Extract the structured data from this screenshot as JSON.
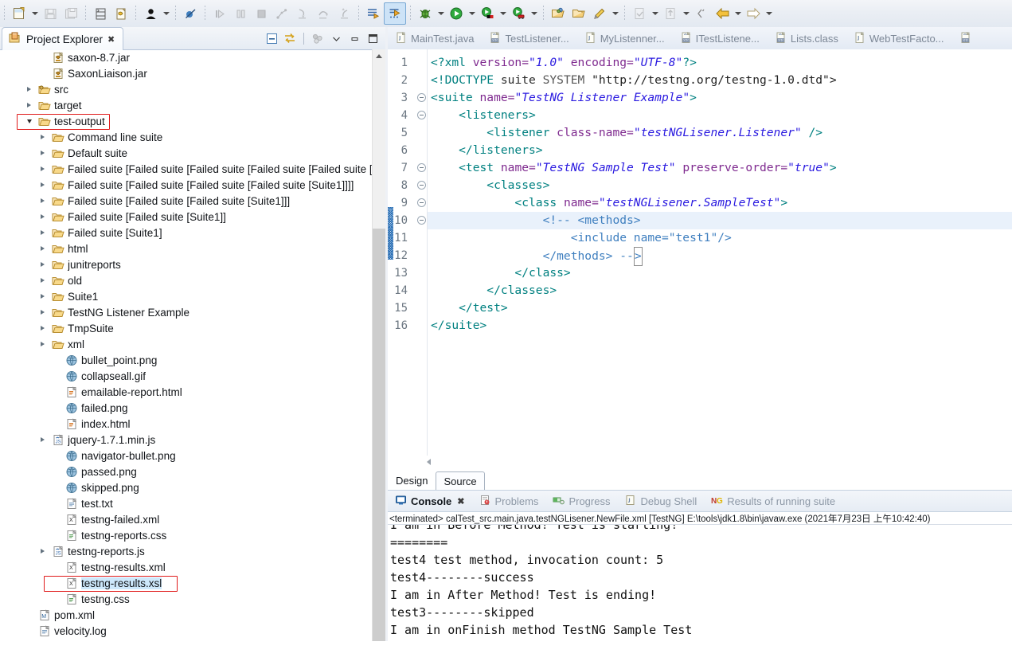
{
  "toolbar": {
    "groups": [
      {
        "items": [
          {
            "icon": "new-wizard-icon",
            "name": "new-button",
            "dropdown": true,
            "enabled": true
          },
          {
            "icon": "save-icon",
            "name": "save-button",
            "dropdown": false,
            "enabled": false
          },
          {
            "icon": "save-all-icon",
            "name": "save-all-button",
            "dropdown": false,
            "enabled": false
          }
        ]
      },
      {
        "items": [
          {
            "icon": "print-icon",
            "name": "print-button",
            "dropdown": false,
            "enabled": true
          },
          {
            "icon": "refresh-xml-icon",
            "name": "refresh-button",
            "dropdown": false,
            "enabled": true
          }
        ]
      },
      {
        "items": [
          {
            "icon": "person-icon",
            "name": "user-button",
            "dropdown": true,
            "enabled": true
          }
        ]
      },
      {
        "items": [
          {
            "icon": "skip-breakpoints-icon",
            "name": "skip-all-breakpoints-button",
            "dropdown": false,
            "enabled": true
          }
        ]
      },
      {
        "items": [
          {
            "icon": "resume-icon",
            "name": "resume-button",
            "dropdown": false,
            "enabled": false
          },
          {
            "icon": "suspend-icon",
            "name": "suspend-button",
            "dropdown": false,
            "enabled": false
          },
          {
            "icon": "terminate-icon",
            "name": "terminate-button",
            "dropdown": false,
            "enabled": false
          },
          {
            "icon": "disconnect-icon",
            "name": "disconnect-button",
            "dropdown": false,
            "enabled": false
          },
          {
            "icon": "step-into-icon",
            "name": "step-into-button",
            "dropdown": false,
            "enabled": false
          },
          {
            "icon": "step-over-icon",
            "name": "step-over-button",
            "dropdown": false,
            "enabled": false
          },
          {
            "icon": "step-return-icon",
            "name": "step-return-button",
            "dropdown": false,
            "enabled": false
          }
        ]
      },
      {
        "items": [
          {
            "icon": "next-annotation-icon",
            "name": "next-annotation-button",
            "dropdown": false,
            "enabled": true
          },
          {
            "icon": "previous-annotation-icon",
            "name": "toggle-mark-occurrences-button",
            "dropdown": false,
            "enabled": true,
            "selected": true
          }
        ]
      },
      {
        "items": [
          {
            "icon": "debug-icon",
            "name": "debug-button",
            "dropdown": true,
            "enabled": true
          },
          {
            "icon": "run-icon",
            "name": "run-button",
            "dropdown": true,
            "enabled": true
          },
          {
            "icon": "coverage-icon",
            "name": "coverage-button",
            "dropdown": true,
            "enabled": true
          },
          {
            "icon": "run-last-tool-icon",
            "name": "external-tools-button",
            "dropdown": true,
            "enabled": true
          }
        ]
      },
      {
        "items": [
          {
            "icon": "new-package-icon",
            "name": "new-package-button",
            "dropdown": false,
            "enabled": true
          },
          {
            "icon": "open-folder-icon",
            "name": "open-type-button",
            "dropdown": false,
            "enabled": true
          },
          {
            "icon": "pencil-icon",
            "name": "edit-button",
            "dropdown": true,
            "enabled": true
          }
        ]
      },
      {
        "items": [
          {
            "icon": "search-next-icon",
            "name": "next-edit-button",
            "dropdown": true,
            "enabled": false
          },
          {
            "icon": "previous-edit-icon",
            "name": "previous-edit-button",
            "dropdown": true,
            "enabled": false
          },
          {
            "icon": "back-small-icon",
            "name": "last-edit-location-button",
            "dropdown": false,
            "enabled": true
          }
        ]
      },
      {
        "items": [
          {
            "icon": "back-arrow-icon",
            "name": "back-button",
            "dropdown": true,
            "enabled": true
          },
          {
            "icon": "forward-arrow-icon",
            "name": "forward-button",
            "dropdown": true,
            "enabled": false
          }
        ]
      }
    ]
  },
  "project_explorer": {
    "title": "Project Explorer",
    "close_label": "✖",
    "view_tools": [
      {
        "name": "collapse-all-icon",
        "label": "collapse-all"
      },
      {
        "name": "link-with-editor-icon",
        "label": "link-with-editor"
      },
      {
        "name": "view-menu-icon",
        "label": "view-menu"
      },
      {
        "name": "view-chevron-icon",
        "label": "view-chevron"
      },
      {
        "name": "minimize-icon",
        "label": "minimize"
      },
      {
        "name": "maximize-icon",
        "label": "maximize"
      }
    ],
    "tree": [
      {
        "label": "saxon-8.7.jar",
        "indent": 2,
        "twisty": "none",
        "icon": "jar-icon"
      },
      {
        "label": "SaxonLiaison.jar",
        "indent": 2,
        "twisty": "none",
        "icon": "jar-icon"
      },
      {
        "label": "src",
        "indent": 1,
        "twisty": "closed",
        "icon": "source-folder-icon"
      },
      {
        "label": "target",
        "indent": 1,
        "twisty": "closed",
        "icon": "folder-icon"
      },
      {
        "label": "test-output",
        "indent": 1,
        "twisty": "open",
        "icon": "folder-icon",
        "highlight": "red-box"
      },
      {
        "label": "Command line suite",
        "indent": 2,
        "twisty": "closed",
        "icon": "folder-icon"
      },
      {
        "label": "Default suite",
        "indent": 2,
        "twisty": "closed",
        "icon": "folder-icon"
      },
      {
        "label": "Failed suite [Failed suite [Failed suite [Failed suite [Failed suite [Suit",
        "indent": 2,
        "twisty": "closed",
        "icon": "folder-icon"
      },
      {
        "label": "Failed suite [Failed suite [Failed suite [Failed suite [Suite1]]]]",
        "indent": 2,
        "twisty": "closed",
        "icon": "folder-icon"
      },
      {
        "label": "Failed suite [Failed suite [Failed suite [Suite1]]]",
        "indent": 2,
        "twisty": "closed",
        "icon": "folder-icon"
      },
      {
        "label": "Failed suite [Failed suite [Suite1]]",
        "indent": 2,
        "twisty": "closed",
        "icon": "folder-icon"
      },
      {
        "label": "Failed suite [Suite1]",
        "indent": 2,
        "twisty": "closed",
        "icon": "folder-icon"
      },
      {
        "label": "html",
        "indent": 2,
        "twisty": "closed",
        "icon": "folder-icon"
      },
      {
        "label": "junitreports",
        "indent": 2,
        "twisty": "closed",
        "icon": "folder-icon"
      },
      {
        "label": "old",
        "indent": 2,
        "twisty": "closed",
        "icon": "folder-icon"
      },
      {
        "label": "Suite1",
        "indent": 2,
        "twisty": "closed",
        "icon": "folder-icon"
      },
      {
        "label": "TestNG Listener Example",
        "indent": 2,
        "twisty": "closed",
        "icon": "folder-icon"
      },
      {
        "label": "TmpSuite",
        "indent": 2,
        "twisty": "closed",
        "icon": "folder-icon"
      },
      {
        "label": "xml",
        "indent": 2,
        "twisty": "closed",
        "icon": "folder-icon"
      },
      {
        "label": "bullet_point.png",
        "indent": 3,
        "twisty": "none",
        "icon": "image-globe-icon"
      },
      {
        "label": "collapseall.gif",
        "indent": 3,
        "twisty": "none",
        "icon": "image-globe-icon"
      },
      {
        "label": "emailable-report.html",
        "indent": 3,
        "twisty": "none",
        "icon": "html-file-icon"
      },
      {
        "label": "failed.png",
        "indent": 3,
        "twisty": "none",
        "icon": "image-globe-icon"
      },
      {
        "label": "index.html",
        "indent": 3,
        "twisty": "none",
        "icon": "html-file-icon"
      },
      {
        "label": "jquery-1.7.1.min.js",
        "indent": 2,
        "twisty": "closed",
        "icon": "js-file-icon"
      },
      {
        "label": "navigator-bullet.png",
        "indent": 3,
        "twisty": "none",
        "icon": "image-globe-icon"
      },
      {
        "label": "passed.png",
        "indent": 3,
        "twisty": "none",
        "icon": "image-globe-icon"
      },
      {
        "label": "skipped.png",
        "indent": 3,
        "twisty": "none",
        "icon": "image-globe-icon"
      },
      {
        "label": "test.txt",
        "indent": 3,
        "twisty": "none",
        "icon": "text-file-icon"
      },
      {
        "label": "testng-failed.xml",
        "indent": 3,
        "twisty": "none",
        "icon": "xml-file-icon"
      },
      {
        "label": "testng-reports.css",
        "indent": 3,
        "twisty": "none",
        "icon": "css-file-icon"
      },
      {
        "label": "testng-reports.js",
        "indent": 2,
        "twisty": "closed",
        "icon": "js-file-icon"
      },
      {
        "label": "testng-results.xml",
        "indent": 3,
        "twisty": "none",
        "icon": "xml-file-icon"
      },
      {
        "label": "testng-results.xsl",
        "indent": 3,
        "twisty": "none",
        "icon": "xml-file-icon",
        "selected": true,
        "highlight": "red-box"
      },
      {
        "label": "testng.css",
        "indent": 3,
        "twisty": "none",
        "icon": "css-file-icon"
      },
      {
        "label": "pom.xml",
        "indent": 1,
        "twisty": "none",
        "icon": "maven-file-icon"
      },
      {
        "label": "velocity.log",
        "indent": 1,
        "twisty": "none",
        "icon": "text-file-icon"
      }
    ]
  },
  "editor": {
    "tabs": [
      {
        "label": "MainTest.java",
        "icon": "java-file-icon",
        "active": false
      },
      {
        "label": "TestListener...",
        "icon": "class-file-icon",
        "active": false
      },
      {
        "label": "MyListenner...",
        "icon": "java-file-icon",
        "active": false
      },
      {
        "label": "ITestListene...",
        "icon": "class-file-icon",
        "active": false
      },
      {
        "label": "Lists.class",
        "icon": "class-file-icon",
        "active": false
      },
      {
        "label": "WebTestFacto...",
        "icon": "java-file-icon",
        "active": false
      },
      {
        "label": "",
        "icon": "class-file-icon",
        "active": false
      }
    ],
    "bottom_tabs": [
      {
        "label": "Design",
        "active": false
      },
      {
        "label": "Source",
        "active": true
      }
    ],
    "lines": [
      {
        "n": "1",
        "fold": false,
        "parts": [
          {
            "t": "<?xml ",
            "c": "tagc"
          },
          {
            "t": "version=",
            "c": "attrn"
          },
          {
            "t": "\"1.0\"",
            "c": "attrv"
          },
          {
            "t": " ",
            "c": "plain"
          },
          {
            "t": "encoding=",
            "c": "attrn"
          },
          {
            "t": "\"UTF-8\"",
            "c": "attrv"
          },
          {
            "t": "?>",
            "c": "tagc"
          }
        ]
      },
      {
        "n": "2",
        "fold": false,
        "parts": [
          {
            "t": "<!DOCTYPE ",
            "c": "tagc"
          },
          {
            "t": "suite ",
            "c": "plain"
          },
          {
            "t": "SYSTEM ",
            "c": "dtd"
          },
          {
            "t": "\"http://testng.org/testng-1.0.dtd\">",
            "c": "str-plain"
          }
        ]
      },
      {
        "n": "3",
        "fold": true,
        "parts": [
          {
            "t": "<suite ",
            "c": "tagc"
          },
          {
            "t": "name=",
            "c": "attrn"
          },
          {
            "t": "\"TestNG Listener Example\"",
            "c": "attrv"
          },
          {
            "t": ">",
            "c": "tagc"
          }
        ]
      },
      {
        "n": "4",
        "fold": true,
        "parts": [
          {
            "t": "    <listeners>",
            "c": "tagc"
          }
        ]
      },
      {
        "n": "5",
        "fold": false,
        "parts": [
          {
            "t": "        <listener ",
            "c": "tagc"
          },
          {
            "t": "class-name=",
            "c": "attrn"
          },
          {
            "t": "\"testNGLisener.Listener\"",
            "c": "attrv"
          },
          {
            "t": " />",
            "c": "tagc"
          }
        ]
      },
      {
        "n": "6",
        "fold": false,
        "parts": [
          {
            "t": "    </listeners>",
            "c": "tagc"
          }
        ]
      },
      {
        "n": "7",
        "fold": true,
        "parts": [
          {
            "t": "    <test ",
            "c": "tagc"
          },
          {
            "t": "name=",
            "c": "attrn"
          },
          {
            "t": "\"TestNG Sample Test\"",
            "c": "attrv"
          },
          {
            "t": " ",
            "c": "plain"
          },
          {
            "t": "preserve-order=",
            "c": "attrn"
          },
          {
            "t": "\"true\"",
            "c": "attrv"
          },
          {
            "t": ">",
            "c": "tagc"
          }
        ]
      },
      {
        "n": "8",
        "fold": true,
        "parts": [
          {
            "t": "        <classes>",
            "c": "tagc"
          }
        ]
      },
      {
        "n": "9",
        "fold": true,
        "parts": [
          {
            "t": "            <class ",
            "c": "tagc"
          },
          {
            "t": "name=",
            "c": "attrn"
          },
          {
            "t": "\"testNGLisener.SampleTest\"",
            "c": "attrv"
          },
          {
            "t": ">",
            "c": "tagc"
          }
        ]
      },
      {
        "n": "10",
        "fold": true,
        "highlight": true,
        "parts": [
          {
            "t": "                <!-- <methods>",
            "c": "cmt"
          }
        ]
      },
      {
        "n": "11",
        "fold": false,
        "parts": [
          {
            "t": "                    <include name=\"test1\"/>",
            "c": "cmt"
          }
        ]
      },
      {
        "n": "12",
        "fold": false,
        "parts": [
          {
            "t": "                </methods> --",
            "c": "cmt"
          },
          {
            "t": ">",
            "c": "cmt-caret"
          }
        ]
      },
      {
        "n": "13",
        "fold": false,
        "parts": [
          {
            "t": "            </class>",
            "c": "tagc"
          }
        ]
      },
      {
        "n": "14",
        "fold": false,
        "parts": [
          {
            "t": "        </classes>",
            "c": "tagc"
          }
        ]
      },
      {
        "n": "15",
        "fold": false,
        "parts": [
          {
            "t": "    </test>",
            "c": "tagc"
          }
        ]
      },
      {
        "n": "16",
        "fold": false,
        "parts": [
          {
            "t": "</suite>",
            "c": "tagc"
          }
        ]
      }
    ]
  },
  "console": {
    "tabs": [
      {
        "label": "Console",
        "icon": "console-icon",
        "active": true,
        "closable": true
      },
      {
        "label": "Problems",
        "icon": "problems-icon",
        "active": false
      },
      {
        "label": "Progress",
        "icon": "progress-icon",
        "active": false
      },
      {
        "label": "Debug Shell",
        "icon": "debug-shell-icon",
        "active": false
      },
      {
        "label": "Results of running suite",
        "icon": "testng-icon",
        "active": false
      }
    ],
    "header": "<terminated> calTest_src.main.java.testNGLisener.NewFile.xml [TestNG] E:\\tools\\jdk1.8\\bin\\javaw.exe (2021年7月23日 上午10:42:40)",
    "output": [
      "I am in Before Method! Test is starting!",
      "========",
      "test4 test method, invocation count: 5",
      "test4--------success",
      "I am in After Method! Test is ending!",
      "test3--------skipped",
      "I am in onFinish method TestNG Sample Test"
    ]
  },
  "colors": {
    "accent": "#cde3f7",
    "selection": "#cde8fb",
    "highlight_box": "#e01b1b",
    "tag": "#008080",
    "attr_name": "#7f2a8f",
    "attr_value": "#2a1ae0",
    "comment": "#3f7fbf",
    "line_highlight": "#e9f1fb"
  }
}
